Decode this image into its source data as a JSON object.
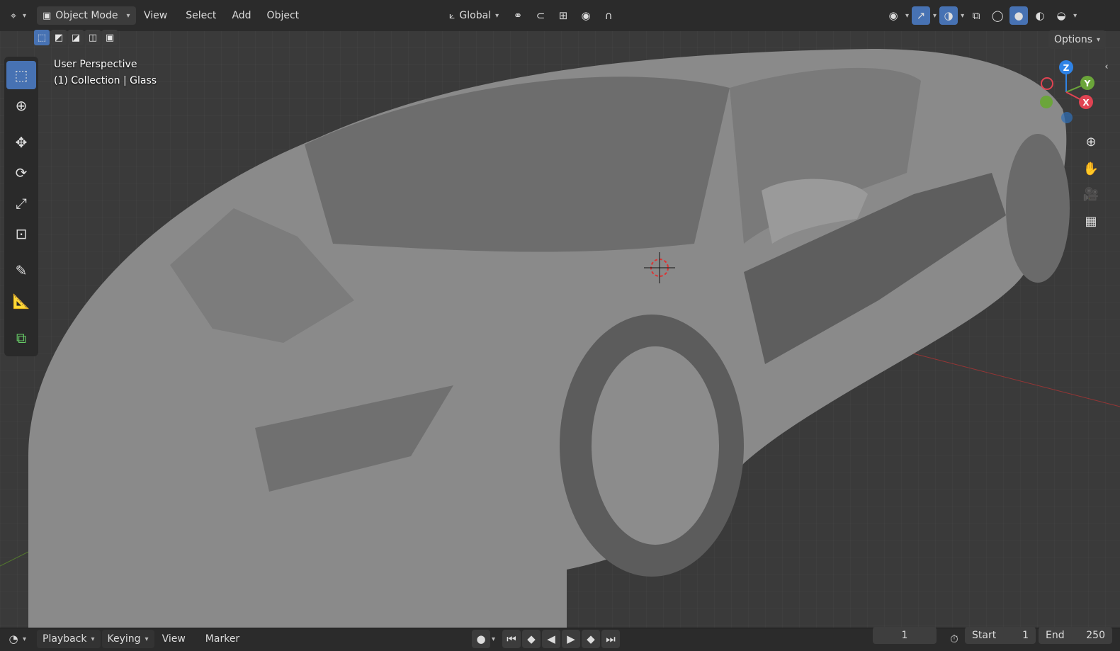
{
  "header": {
    "mode_label": "Object Mode",
    "menus": [
      "View",
      "Select",
      "Add",
      "Object"
    ],
    "transform_orientation": "Global",
    "options_label": "Options"
  },
  "viewport": {
    "perspective_label": "User Perspective",
    "collection_label": "(1) Collection | Glass",
    "axis_labels": {
      "z": "Z",
      "y": "Y",
      "x": "X"
    }
  },
  "timeline": {
    "menus": [
      "Playback",
      "Keying",
      "View",
      "Marker"
    ],
    "current_frame": "1",
    "start_label": "Start",
    "start_value": "1",
    "end_label": "End",
    "end_value": "250"
  },
  "colors": {
    "accent": "#4772b3",
    "axis_x": "#e04352",
    "axis_y": "#6ba53a",
    "axis_z": "#2f83e6"
  }
}
